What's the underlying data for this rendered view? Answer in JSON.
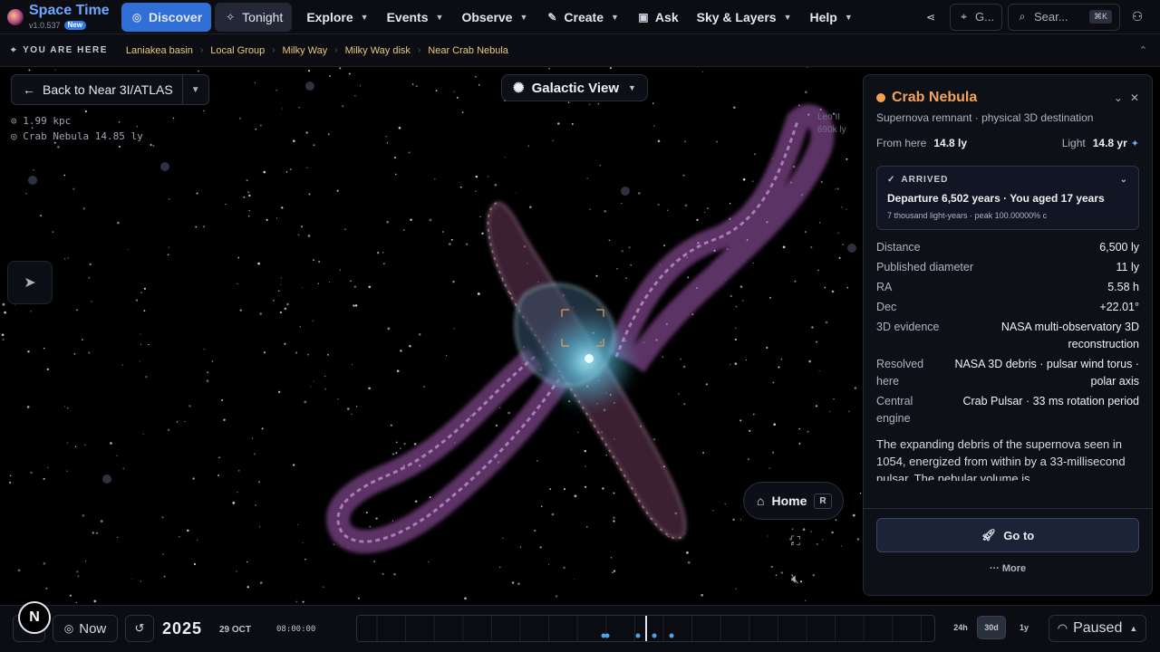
{
  "app": {
    "title": "Space Time",
    "version": "v1.0.537",
    "new_badge": "New"
  },
  "nav": {
    "discover": "Discover",
    "tonight": "Tonight",
    "explore": "Explore",
    "events": "Events",
    "observe": "Observe",
    "create": "Create",
    "ask": "Ask",
    "sky_layers": "Sky & Layers",
    "help": "Help",
    "location_short": "G...",
    "search_placeholder": "Sear...",
    "search_shortcut": "⌘K"
  },
  "breadcrumb": {
    "label": "YOU ARE HERE",
    "items": [
      "Laniakea basin",
      "Local Group",
      "Milky Way",
      "Milky Way disk",
      "Near Crab Nebula"
    ]
  },
  "scene": {
    "back_label": "Back to Near 3I/ATLAS",
    "readout_distance": "1.99 kpc",
    "readout_target": "Crab Nebula 14.85 ly",
    "view_label": "Galactic View",
    "background_label_name": "Leo II",
    "background_label_dist": "690k ly",
    "home_label": "Home",
    "home_shortcut": "R"
  },
  "panel": {
    "title": "Crab Nebula",
    "subtitle": "Supernova remnant · physical 3D destination",
    "from_here_label": "From here",
    "from_here_value": "14.8 ly",
    "light_label": "Light",
    "light_value": "14.8 yr",
    "arrived": {
      "status": "ARRIVED",
      "main": "Departure 6,502 years · You aged 17 years",
      "detail": "7 thousand light-years · peak 100.00000% c"
    },
    "facts": [
      {
        "k": "Distance",
        "v": "6,500 ly"
      },
      {
        "k": "Published diameter",
        "v": "11 ly"
      },
      {
        "k": "RA",
        "v": "5.58 h"
      },
      {
        "k": "Dec",
        "v": "+22.01°"
      },
      {
        "k": "3D evidence",
        "v": "NASA multi-observatory 3D reconstruction"
      },
      {
        "k": "Resolved here",
        "v": "NASA 3D debris · pulsar wind torus · polar axis"
      },
      {
        "k": "Central engine",
        "v": "Crab Pulsar · 33 ms rotation period"
      }
    ],
    "description": "The expanding debris of the supernova seen in 1054, energized from within by a 33-millisecond pulsar. The nebular volume is",
    "goto_label": "Go to",
    "more_label": "More"
  },
  "bottom": {
    "north_label": "N",
    "now_label": "Now",
    "year": "2025",
    "date": "29 OCT",
    "time": "08:00:00",
    "scales": [
      "24h",
      "30d",
      "1y"
    ],
    "active_scale": "30d",
    "paused_label": "Paused"
  },
  "colors": {
    "accent": "#2f6fd6",
    "title_orange": "#f5a35a",
    "crumb_gold": "#e9c97b",
    "nebula_pink": "#b568c9",
    "nebula_cyan": "#8fe0ee"
  }
}
